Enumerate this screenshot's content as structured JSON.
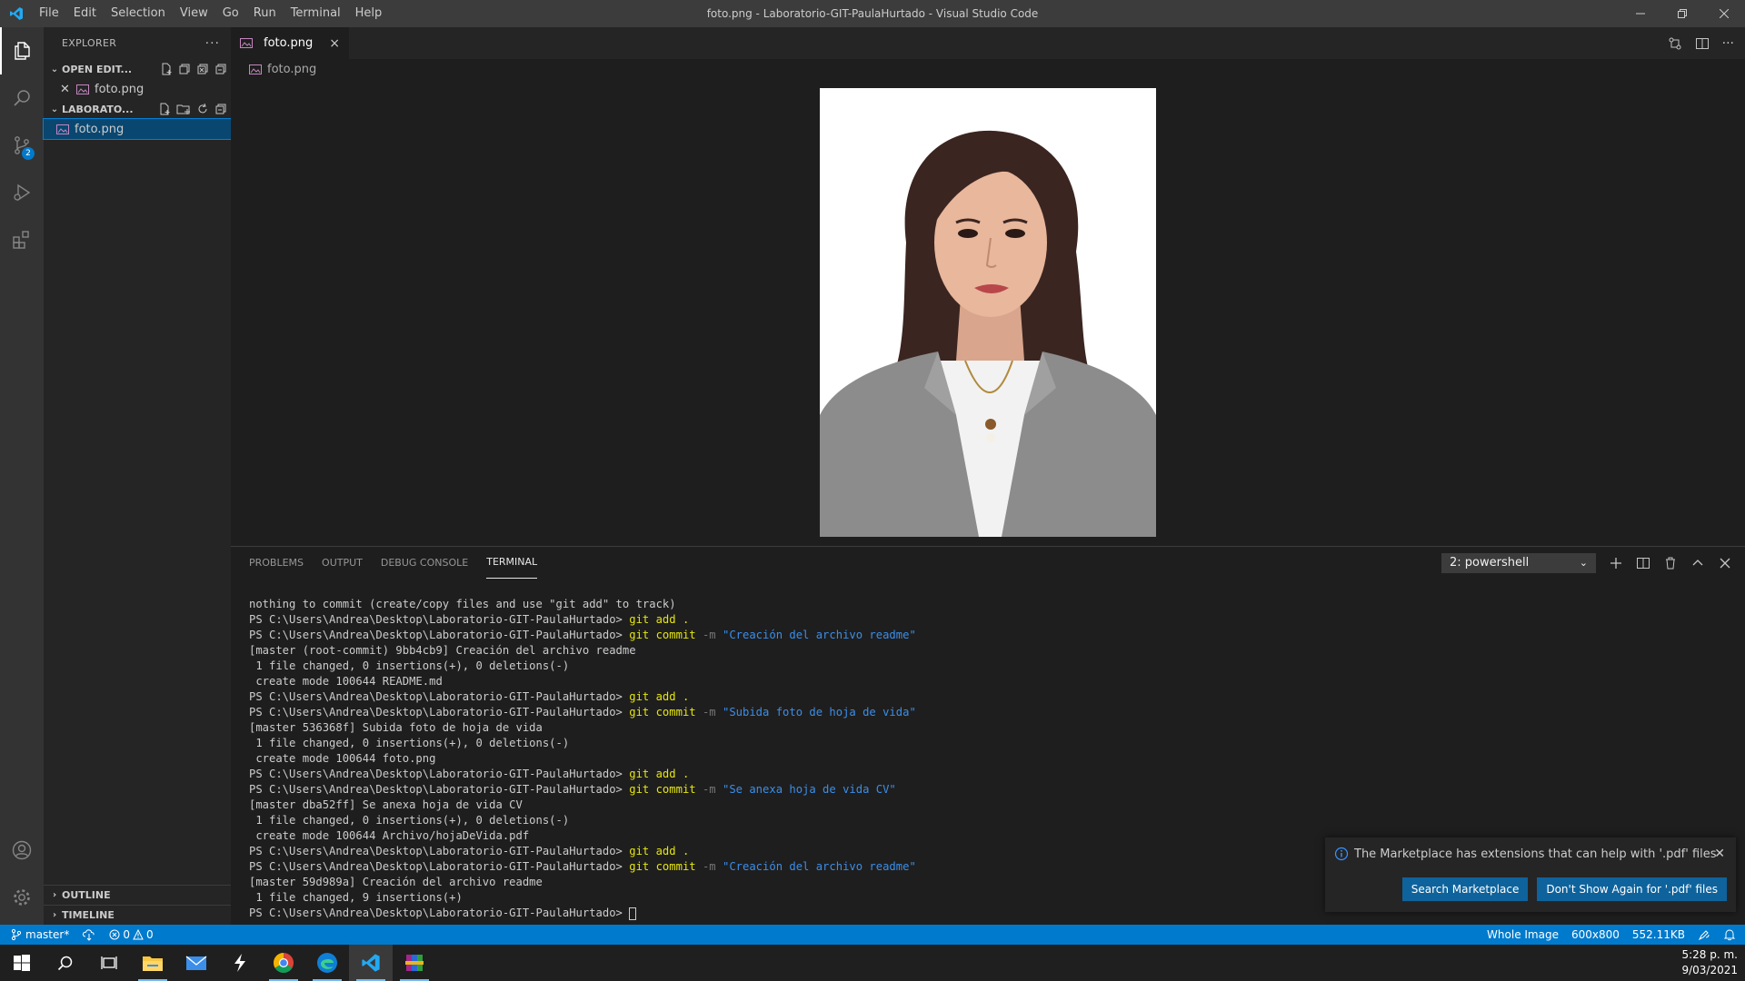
{
  "titlebar": {
    "menu": [
      "File",
      "Edit",
      "Selection",
      "View",
      "Go",
      "Run",
      "Terminal",
      "Help"
    ],
    "window_title": "foto.png - Laboratorio-GIT-PaulaHurtado - Visual Studio Code"
  },
  "activitybar": {
    "scm_badge": "2"
  },
  "sidebar": {
    "title": "EXPLORER",
    "open_editors_label": "OPEN EDIT...",
    "open_editor_file": "foto.png",
    "folder_label": "LABORATO...",
    "folder_file": "foto.png",
    "outline_label": "OUTLINE",
    "timeline_label": "TIMELINE"
  },
  "editor": {
    "tab_label": "foto.png",
    "tab_close": "×",
    "breadcrumb": "foto.png"
  },
  "panel": {
    "tabs": [
      "PROBLEMS",
      "OUTPUT",
      "DEBUG CONSOLE",
      "TERMINAL"
    ],
    "active_tab": "TERMINAL",
    "terminal_select": "2: powershell",
    "prompt": "PS C:\\Users\\Andrea\\Desktop\\Laboratorio-GIT-PaulaHurtado> ",
    "lines": [
      {
        "type": "out",
        "text": "nothing to commit (create/copy files and use \"git add\" to track)"
      },
      {
        "type": "add"
      },
      {
        "type": "commit",
        "msg": "\"Creación del archivo readme\""
      },
      {
        "type": "out",
        "text": "[master (root-commit) 9bb4cb9] Creación del archivo readme"
      },
      {
        "type": "out",
        "text": " 1 file changed, 0 insertions(+), 0 deletions(-)"
      },
      {
        "type": "out",
        "text": " create mode 100644 README.md"
      },
      {
        "type": "add"
      },
      {
        "type": "commit",
        "msg": "\"Subida foto de hoja de vida\""
      },
      {
        "type": "out",
        "text": "[master 536368f] Subida foto de hoja de vida"
      },
      {
        "type": "out",
        "text": " 1 file changed, 0 insertions(+), 0 deletions(-)"
      },
      {
        "type": "out",
        "text": " create mode 100644 foto.png"
      },
      {
        "type": "add"
      },
      {
        "type": "commit",
        "msg": "\"Se anexa hoja de vida CV\""
      },
      {
        "type": "out",
        "text": "[master dba52ff] Se anexa hoja de vida CV"
      },
      {
        "type": "out",
        "text": " 1 file changed, 0 insertions(+), 0 deletions(-)"
      },
      {
        "type": "out",
        "text": " create mode 100644 Archivo/hojaDeVida.pdf"
      },
      {
        "type": "add"
      },
      {
        "type": "commit",
        "msg": "\"Creación del archivo readme\""
      },
      {
        "type": "out",
        "text": "[master 59d989a] Creación del archivo readme"
      },
      {
        "type": "out",
        "text": " 1 file changed, 9 insertions(+)"
      },
      {
        "type": "prompt"
      }
    ],
    "git_add": "git add .",
    "git_commit": "git commit",
    "flag": "-m"
  },
  "notification": {
    "message": "The Marketplace has extensions that can help with '.pdf' files",
    "primary_button": "Search Marketplace",
    "secondary_button": "Don't Show Again for '.pdf' files"
  },
  "statusbar": {
    "branch": "master*",
    "errors": "0",
    "warnings": "0",
    "zoom": "Whole Image",
    "dimensions": "600x800",
    "size": "552.11KB"
  },
  "taskbar": {
    "time": "5:28 p. m.",
    "date": "9/03/2021"
  },
  "colors": {
    "accent": "#007acc",
    "terminal_command": "#e5e510",
    "terminal_string": "#3b8eea",
    "image_icon": "#c586c0"
  }
}
